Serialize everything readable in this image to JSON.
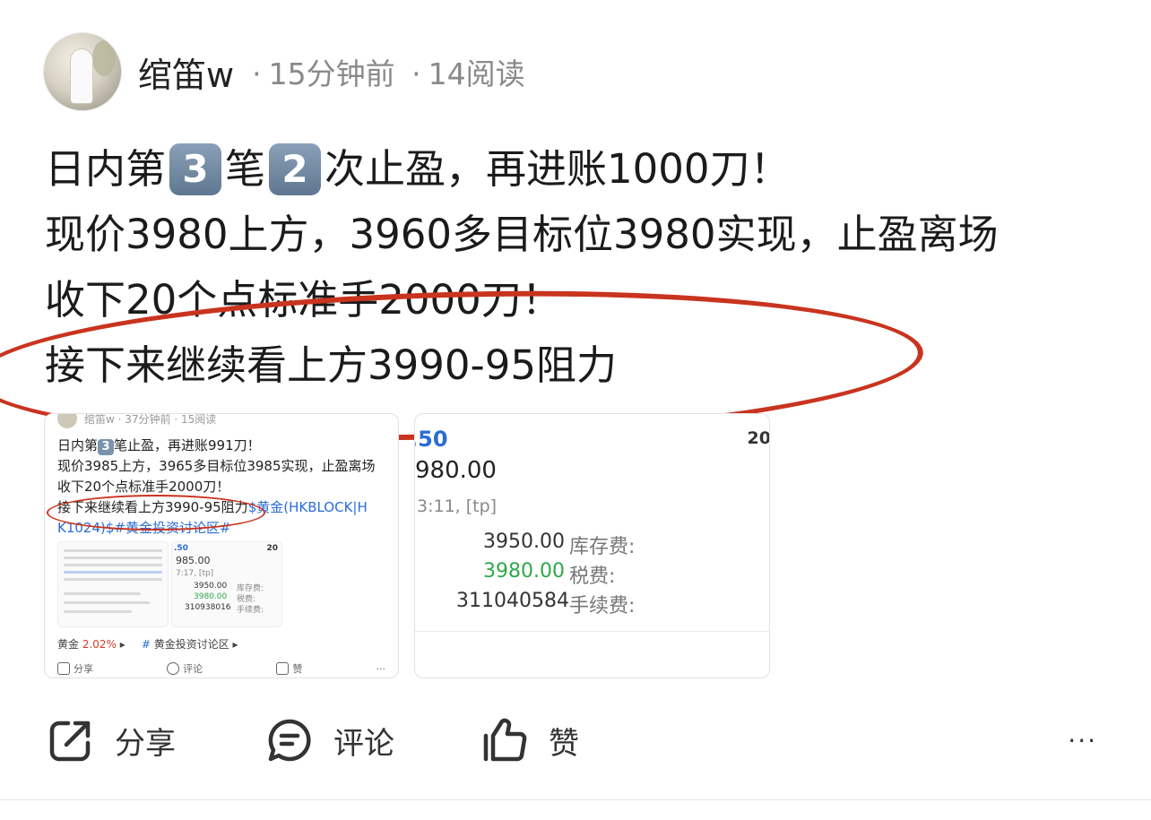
{
  "author": {
    "name": "绾笛w",
    "time": "15分钟前",
    "reads": "14阅读",
    "dot": "·"
  },
  "post": {
    "line1": {
      "a": "日内第",
      "n1": "3",
      "b": "笔",
      "n2": "2",
      "c": "次止盈，再进账1000刀！"
    },
    "line2": "现价3980上方，3960多目标位3980实现，止盈离场",
    "line3": "收下20个点标准手2000刀！",
    "line4": "接下来继续看上方3990-95阻力"
  },
  "card1": {
    "header": "绾笛w · 37分钟前 · 15阅读",
    "l1a": "日内第",
    "l1n": "3",
    "l1b": "笔止盈，再进账991刀！",
    "l2": "现价3985上方，3965多目标位3985实现，止盈离场",
    "l3": "收下20个点标准手2000刀！",
    "l4": "接下来继续看上方3990-95阻力",
    "l4link": "$黄金(HKBLOCK|H",
    "l5": "K1024)$#黄金投资讨论区#",
    "thumb": {
      "p1": ".50",
      "p2": "20",
      "p3": "985.00",
      "p4": "7:17, [tp]",
      "v1": "3950.00",
      "v2": "3980.00",
      "v3": "310938016",
      "k1": "库存费:",
      "k2": "税费:",
      "k3": "手续费:"
    },
    "tag_gold": "黄金",
    "tag_pct": "2.02%",
    "tag_hash": "#",
    "tag_topic": "黄金投资讨论区",
    "share": "分享",
    "comment": "评论",
    "like": "赞",
    "more": "···"
  },
  "card2": {
    "price": ".50",
    "pct": "20",
    "big": "980.00",
    "time": "3:11, [tp]",
    "v1": "3950.00",
    "k1": "库存费:",
    "v2": "3980.00",
    "k2": "税费:",
    "v3": "311040584",
    "k3": "手续费:"
  },
  "actions": {
    "share": "分享",
    "comment": "评论",
    "like": "赞",
    "more": "···"
  },
  "colors": {
    "annotation": "#c9341f",
    "link": "#2b6cd6",
    "profit": "#2ea84a"
  }
}
